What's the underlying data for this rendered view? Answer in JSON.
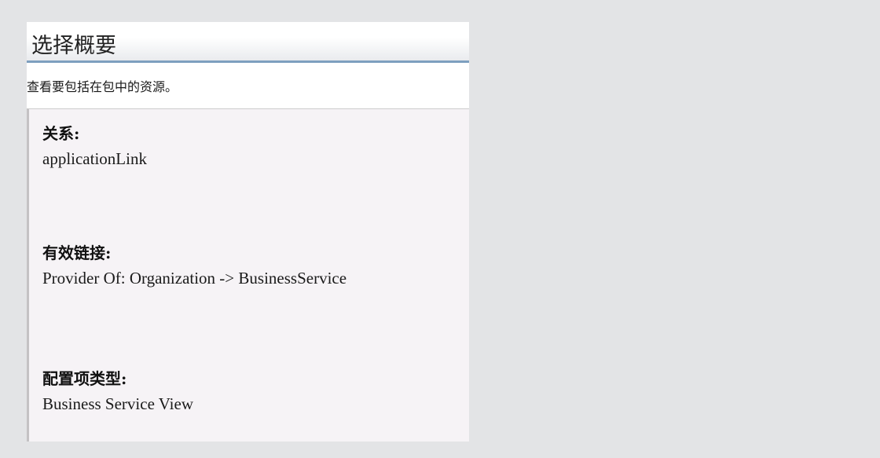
{
  "panel": {
    "title": "选择概要",
    "description": "查看要包括在包中的资源。"
  },
  "sections": [
    {
      "label": "关系:",
      "value": "applicationLink"
    },
    {
      "label": "有效链接:",
      "value": "Provider Of: Organization -> BusinessService"
    },
    {
      "label": "配置项类型:",
      "value": "Business Service View"
    }
  ]
}
